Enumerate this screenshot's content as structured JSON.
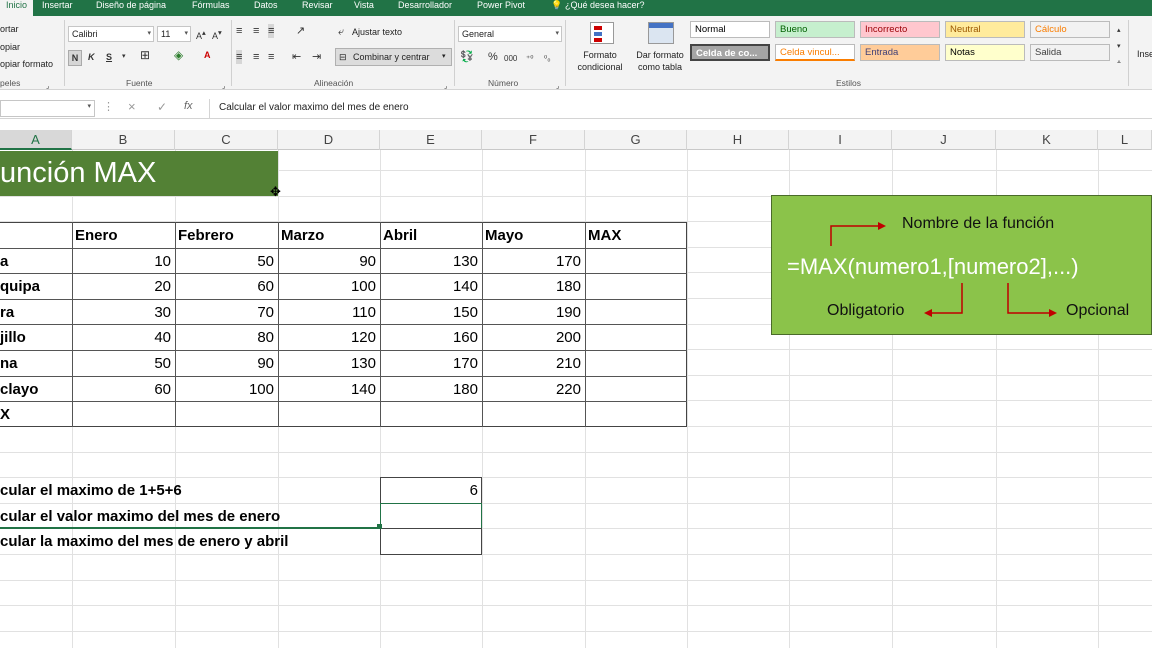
{
  "tabs": [
    "Inicio",
    "Insertar",
    "Diseño de página",
    "Fórmulas",
    "Datos",
    "Revisar",
    "Vista",
    "Desarrollador",
    "Power Pivot",
    "¿Qué desea hacer?"
  ],
  "ribbon": {
    "clipboard": {
      "cut": "ortar",
      "copy": "opiar",
      "painter": "opiar formato",
      "label": "peles"
    },
    "font": {
      "name": "Calibri",
      "size": "11",
      "label": "Fuente",
      "bold": "N",
      "italic": "K",
      "underline": "S"
    },
    "alignment": {
      "wrap": "Ajustar texto",
      "merge": "Combinar y centrar",
      "label": "Alineación"
    },
    "number": {
      "format": "General",
      "label": "Número",
      "percent": "%",
      "thousands": "000"
    },
    "styles": {
      "cond_format": "Formato condicional",
      "table_format": "Dar formato como tabla",
      "label": "Estilos",
      "cells": [
        {
          "text": "Normal",
          "bg": "#ffffff",
          "color": "#000000"
        },
        {
          "text": "Bueno",
          "bg": "#c6efce",
          "color": "#006100"
        },
        {
          "text": "Incorrecto",
          "bg": "#ffc7ce",
          "color": "#9c0006"
        },
        {
          "text": "Neutral",
          "bg": "#ffeb9c",
          "color": "#9c5700"
        },
        {
          "text": "Cálculo",
          "bg": "#f2f2f2",
          "color": "#fa7d00"
        },
        {
          "text": "Celda de co...",
          "bg": "#a5a5a5",
          "color": "#ffffff"
        },
        {
          "text": "Celda vincul...",
          "bg": "#ffffff",
          "color": "#fa7d00"
        },
        {
          "text": "Entrada",
          "bg": "#ffcc99",
          "color": "#3f3f76"
        },
        {
          "text": "Notas",
          "bg": "#ffffcc",
          "color": "#000000"
        },
        {
          "text": "Salida",
          "bg": "#f2f2f2",
          "color": "#3f3f3f"
        }
      ]
    },
    "insert": "Inse"
  },
  "formula_bar": {
    "content": "Calcular el valor maximo del mes de enero",
    "cancel": "×",
    "confirm": "✓",
    "fx": "fx"
  },
  "columns": [
    "A",
    "B",
    "C",
    "D",
    "E",
    "F",
    "G",
    "H",
    "I",
    "J",
    "K",
    "L"
  ],
  "sheet": {
    "title": "unción MAX",
    "headers": [
      "Enero",
      "Febrero",
      "Marzo",
      "Abril",
      "Mayo",
      "MAX"
    ],
    "rows": [
      {
        "label": "a",
        "values": [
          "10",
          "50",
          "90",
          "130",
          "170"
        ]
      },
      {
        "label": "quipa",
        "values": [
          "20",
          "60",
          "100",
          "140",
          "180"
        ]
      },
      {
        "label": "ra",
        "values": [
          "30",
          "70",
          "110",
          "150",
          "190"
        ]
      },
      {
        "label": "jillo",
        "values": [
          "40",
          "80",
          "120",
          "160",
          "200"
        ]
      },
      {
        "label": "na",
        "values": [
          "50",
          "90",
          "130",
          "170",
          "210"
        ]
      },
      {
        "label": "clayo",
        "values": [
          "60",
          "100",
          "140",
          "180",
          "220"
        ]
      }
    ],
    "max_label": "X",
    "questions": [
      {
        "text": "cular el maximo de 1+5+6",
        "result": "6"
      },
      {
        "text": "cular el valor maximo del mes de enero",
        "result": ""
      },
      {
        "text": "cular la maximo del mes de enero y abril",
        "result": ""
      }
    ]
  },
  "callout": {
    "name_label": "Nombre de la función",
    "syntax": "=MAX(numero1,[numero2],...)",
    "required": "Obligatorio",
    "optional": "Opcional",
    "bg": "#8bc34a"
  },
  "colors": {
    "accent": "#217346",
    "title_bg": "#538135"
  }
}
